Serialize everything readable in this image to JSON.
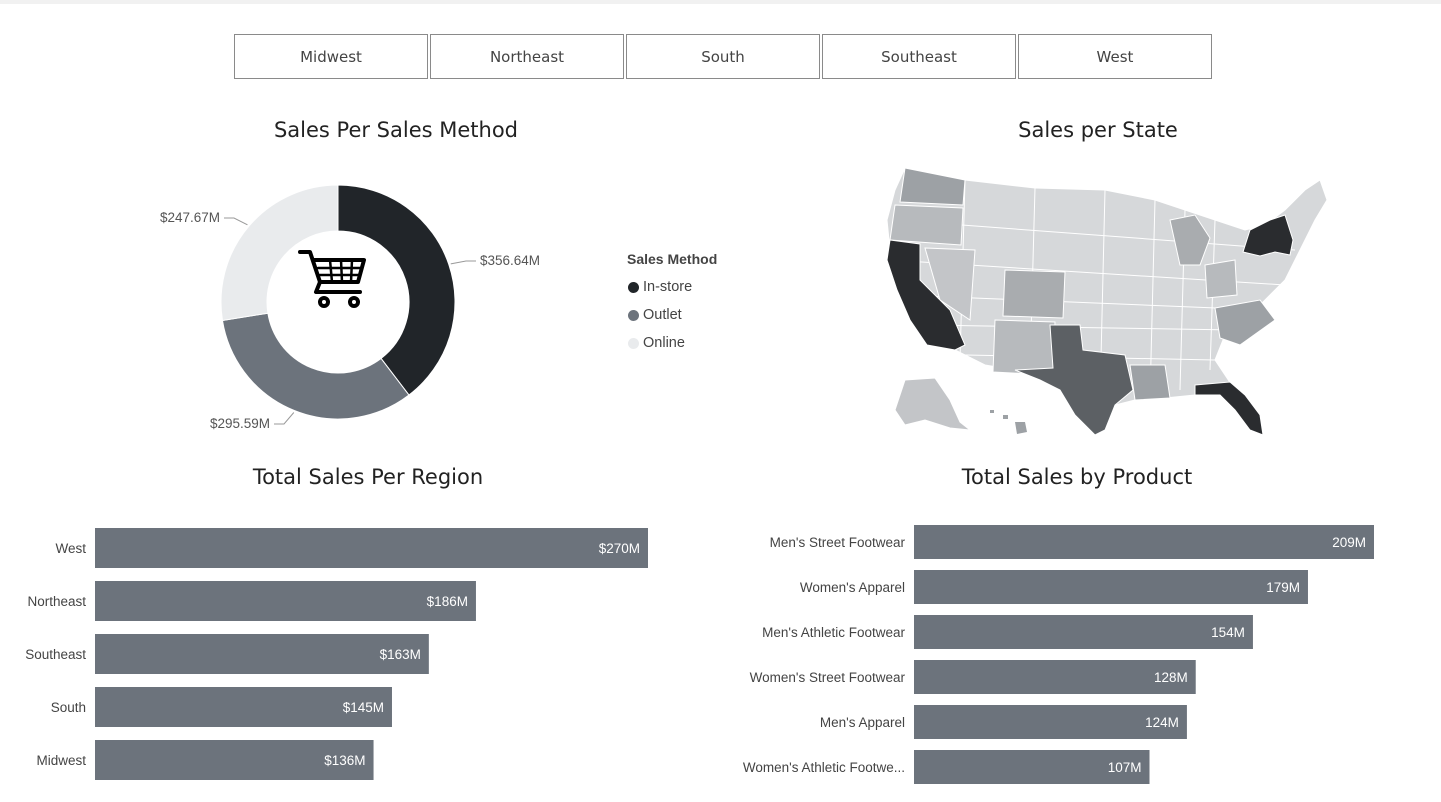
{
  "slicer": {
    "options": [
      "Midwest",
      "Northeast",
      "South",
      "Southeast",
      "West"
    ]
  },
  "colors": {
    "in_store": "#212529",
    "outlet": "#6c737c",
    "online": "#e9ebed",
    "bar": "#6c737c",
    "map_base": "#d6d8da"
  },
  "icons": {
    "donut_center": "shopping-cart-icon"
  },
  "chart_data": [
    {
      "type": "pie",
      "title": "Sales Per Sales Method",
      "donut": true,
      "legend_title": "Sales Method",
      "legend_position": "right",
      "slices": [
        {
          "name": "In-store",
          "value": 356.64,
          "label": "$356.64M"
        },
        {
          "name": "Outlet",
          "value": 295.59,
          "label": "$295.59M"
        },
        {
          "name": "Online",
          "value": 247.67,
          "label": "$247.67M"
        }
      ]
    },
    {
      "type": "map",
      "title": "Sales per State",
      "highlighted": [
        "California",
        "New York",
        "Florida",
        "Texas"
      ]
    },
    {
      "type": "bar",
      "orientation": "horizontal",
      "title": "Total Sales Per Region",
      "categories": [
        "West",
        "Northeast",
        "Southeast",
        "South",
        "Midwest"
      ],
      "values": [
        270,
        186,
        163,
        145,
        136
      ],
      "labels": [
        "$270M",
        "$186M",
        "$163M",
        "$145M",
        "$136M"
      ],
      "xlim": [
        0,
        270
      ]
    },
    {
      "type": "bar",
      "orientation": "horizontal",
      "title": "Total Sales by Product",
      "categories": [
        "Men's Street Footwear",
        "Women's Apparel",
        "Men's Athletic Footwear",
        "Women's Street Footwear",
        "Men's Apparel",
        "Women's Athletic Footwe..."
      ],
      "values": [
        209,
        179,
        154,
        128,
        124,
        107
      ],
      "labels": [
        "209M",
        "179M",
        "154M",
        "128M",
        "124M",
        "107M"
      ],
      "xlim": [
        0,
        209
      ]
    }
  ]
}
